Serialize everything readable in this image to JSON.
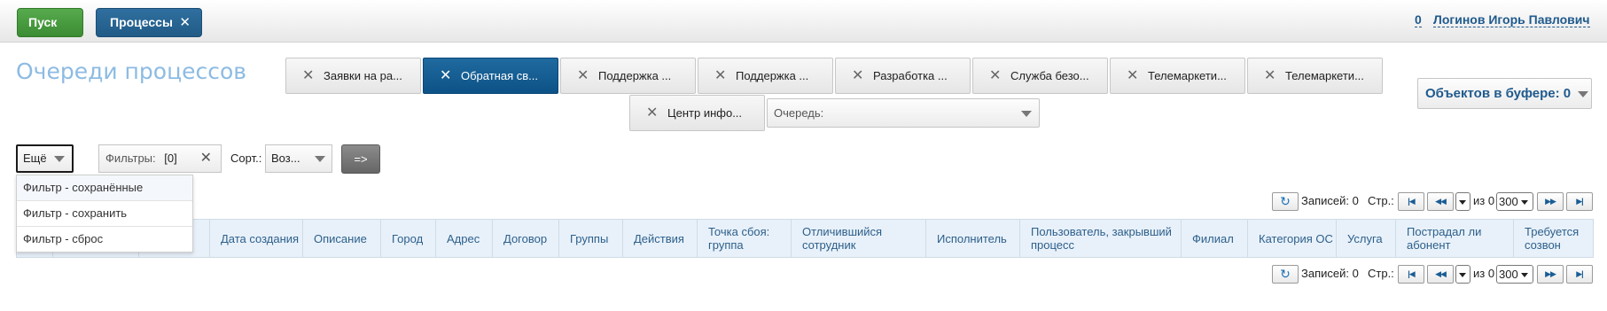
{
  "topbar": {
    "start_label": "Пуск",
    "active_tab_label": "Процессы",
    "active_tab_close": "✕",
    "user_count": "0",
    "user_name": "Логинов Игорь Павлович"
  },
  "page_title": "Очереди процессов",
  "queue_tabs": [
    {
      "label": "Заявки на ра...",
      "close": "✕",
      "active": false
    },
    {
      "label": "Обратная св...",
      "close": "✕",
      "active": true
    },
    {
      "label": "Поддержка ...",
      "close": "✕",
      "active": false
    },
    {
      "label": "Поддержка ...",
      "close": "✕",
      "active": false
    },
    {
      "label": "Разработка ...",
      "close": "✕",
      "active": false
    },
    {
      "label": "Служба безо...",
      "close": "✕",
      "active": false
    },
    {
      "label": "Телемаркети...",
      "close": "✕",
      "active": false
    },
    {
      "label": "Телемаркети...",
      "close": "✕",
      "active": false
    },
    {
      "label": "Центр инфо...",
      "close": "✕",
      "active": false
    }
  ],
  "queue_select": {
    "label": "Очередь:"
  },
  "buffer": {
    "label": "Объектов в буфере: 0"
  },
  "filter_bar": {
    "more_label": "Ещё",
    "filters_label": "Фильтры:",
    "filters_count": "[0]",
    "filters_clear": "✕",
    "sort_label": "Сорт.:",
    "sort_value": "Воз...",
    "go_label": "=>"
  },
  "more_menu": [
    "Фильтр - сохранённые",
    "Фильтр - сохранить",
    "Фильтр - сброс"
  ],
  "pager": {
    "refresh_icon": "↻",
    "records_label": "Записей: 0",
    "page_label": "Стр.:",
    "first": "|◀",
    "prev": "◀◀",
    "of_label": "из 0",
    "page_size": "300",
    "next": "▶▶",
    "last": "▶|"
  },
  "table": {
    "columns": [
      "",
      "",
      "",
      "Дата создания",
      "Описание",
      "Город",
      "Адрес",
      "Договор",
      "Группы",
      "Действия",
      "Точка сбоя: группа",
      "Отличившийся сотрудник",
      "Исполнитель",
      "Пользователь, закрывший процесс",
      "Филиал",
      "Категория ОС",
      "Услуга",
      "Пострадал ли абонент",
      "Требуется созвон"
    ]
  }
}
